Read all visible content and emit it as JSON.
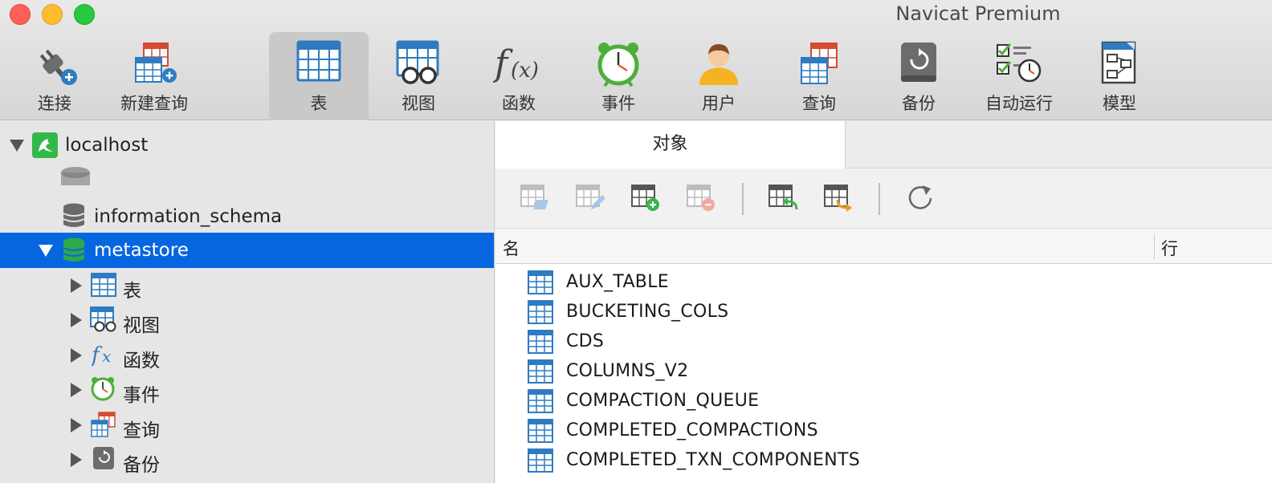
{
  "window": {
    "title": "Navicat Premium"
  },
  "toolbar": {
    "items": [
      {
        "label": "连接",
        "icon": "connection-plug-icon"
      },
      {
        "label": "新建查询",
        "icon": "new-query-icon"
      },
      {
        "label": "表",
        "icon": "table-icon",
        "active": true
      },
      {
        "label": "视图",
        "icon": "view-icon"
      },
      {
        "label": "函数",
        "icon": "function-icon"
      },
      {
        "label": "事件",
        "icon": "event-clock-icon"
      },
      {
        "label": "用户",
        "icon": "user-icon"
      },
      {
        "label": "查询",
        "icon": "query-icon"
      },
      {
        "label": "备份",
        "icon": "backup-icon"
      },
      {
        "label": "自动运行",
        "icon": "automation-icon"
      },
      {
        "label": "模型",
        "icon": "model-icon"
      }
    ]
  },
  "sidebar": {
    "connection": {
      "label": "localhost",
      "icon": "mysql-dolphin-icon"
    },
    "databases": [
      {
        "label": "information_schema",
        "icon": "database-icon"
      },
      {
        "label": "metastore",
        "icon": "database-open-icon",
        "selected": true
      }
    ],
    "children": [
      {
        "label": "表",
        "icon": "table-icon"
      },
      {
        "label": "视图",
        "icon": "view-icon"
      },
      {
        "label": "函数",
        "icon": "function-icon"
      },
      {
        "label": "事件",
        "icon": "event-clock-icon"
      },
      {
        "label": "查询",
        "icon": "query-icon"
      },
      {
        "label": "备份",
        "icon": "backup-icon"
      }
    ]
  },
  "main": {
    "tab_label": "对象",
    "object_toolbar": [
      "open-table-icon",
      "design-table-icon",
      "new-table-icon",
      "delete-table-icon",
      "import-icon",
      "export-icon",
      "refresh-icon"
    ],
    "columns": {
      "name": "名",
      "rows": "行"
    },
    "tables": [
      "AUX_TABLE",
      "BUCKETING_COLS",
      "CDS",
      "COLUMNS_V2",
      "COMPACTION_QUEUE",
      "COMPLETED_COMPACTIONS",
      "COMPLETED_TXN_COMPONENTS"
    ]
  },
  "colors": {
    "selection": "#0566e0",
    "table_icon_blue": "#2f7bc2",
    "event_green": "#4caf3a",
    "alert_red": "#e05a3d"
  }
}
